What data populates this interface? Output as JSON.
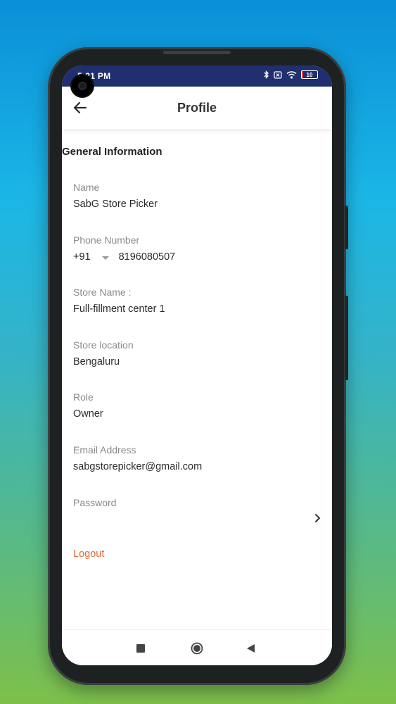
{
  "status_bar": {
    "time": "5:21 PM",
    "battery": "10"
  },
  "header": {
    "title": "Profile"
  },
  "section": {
    "title": "General Information"
  },
  "fields": {
    "name": {
      "label": "Name",
      "value": "SabG Store Picker"
    },
    "phone": {
      "label": "Phone Number",
      "country_code": "+91",
      "value": "8196080507"
    },
    "store_name": {
      "label": "Store Name :",
      "value": "Full-fillment center 1"
    },
    "store_location": {
      "label": "Store location",
      "value": "Bengaluru"
    },
    "role": {
      "label": "Role",
      "value": "Owner"
    },
    "email": {
      "label": "Email Address",
      "value": "sabgstorepicker@gmail.com"
    },
    "password": {
      "label": "Password"
    }
  },
  "actions": {
    "logout_label": "Logout"
  },
  "colors": {
    "status_bar": "#1f2f6f",
    "accent": "#e06a3b",
    "text": "#2a2a2a",
    "label": "#8a8a8a"
  },
  "icons": [
    "back-arrow-icon",
    "chevron-right-icon",
    "bluetooth-icon",
    "wifi-icon",
    "battery-icon",
    "nav-recents-icon",
    "nav-home-icon",
    "nav-back-icon"
  ]
}
